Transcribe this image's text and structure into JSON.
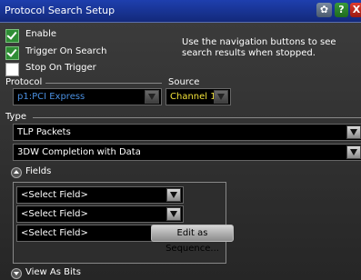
{
  "titlebar": {
    "title": "Protocol Search Setup",
    "icons": [
      "gear-icon",
      "help-icon",
      "close-icon"
    ],
    "help_glyph": "?",
    "close_glyph": "X"
  },
  "options": {
    "enable": {
      "label": "Enable",
      "checked": true
    },
    "trigger_on_search": {
      "label": "Trigger On Search",
      "checked": true
    },
    "stop_on_trigger": {
      "label": "Stop On Trigger",
      "checked": false
    }
  },
  "hint": "Use the navigation buttons to see search results when stopped.",
  "protocol": {
    "label": "Protocol",
    "value": "p1:PCI Express",
    "value_color": "#4a8fe0"
  },
  "source": {
    "label": "Source",
    "value": "Channel 1",
    "value_color": "#f2e23a"
  },
  "type": {
    "label": "Type",
    "packet": "TLP Packets",
    "subtype": "3DW Completion with Data"
  },
  "fields": {
    "label": "Fields",
    "selects": [
      "<Select Field>",
      "<Select Field>",
      "<Select Field>"
    ]
  },
  "edit_sequence_label": "Edit as Sequence...",
  "view_as_bits_label": "View As Bits"
}
